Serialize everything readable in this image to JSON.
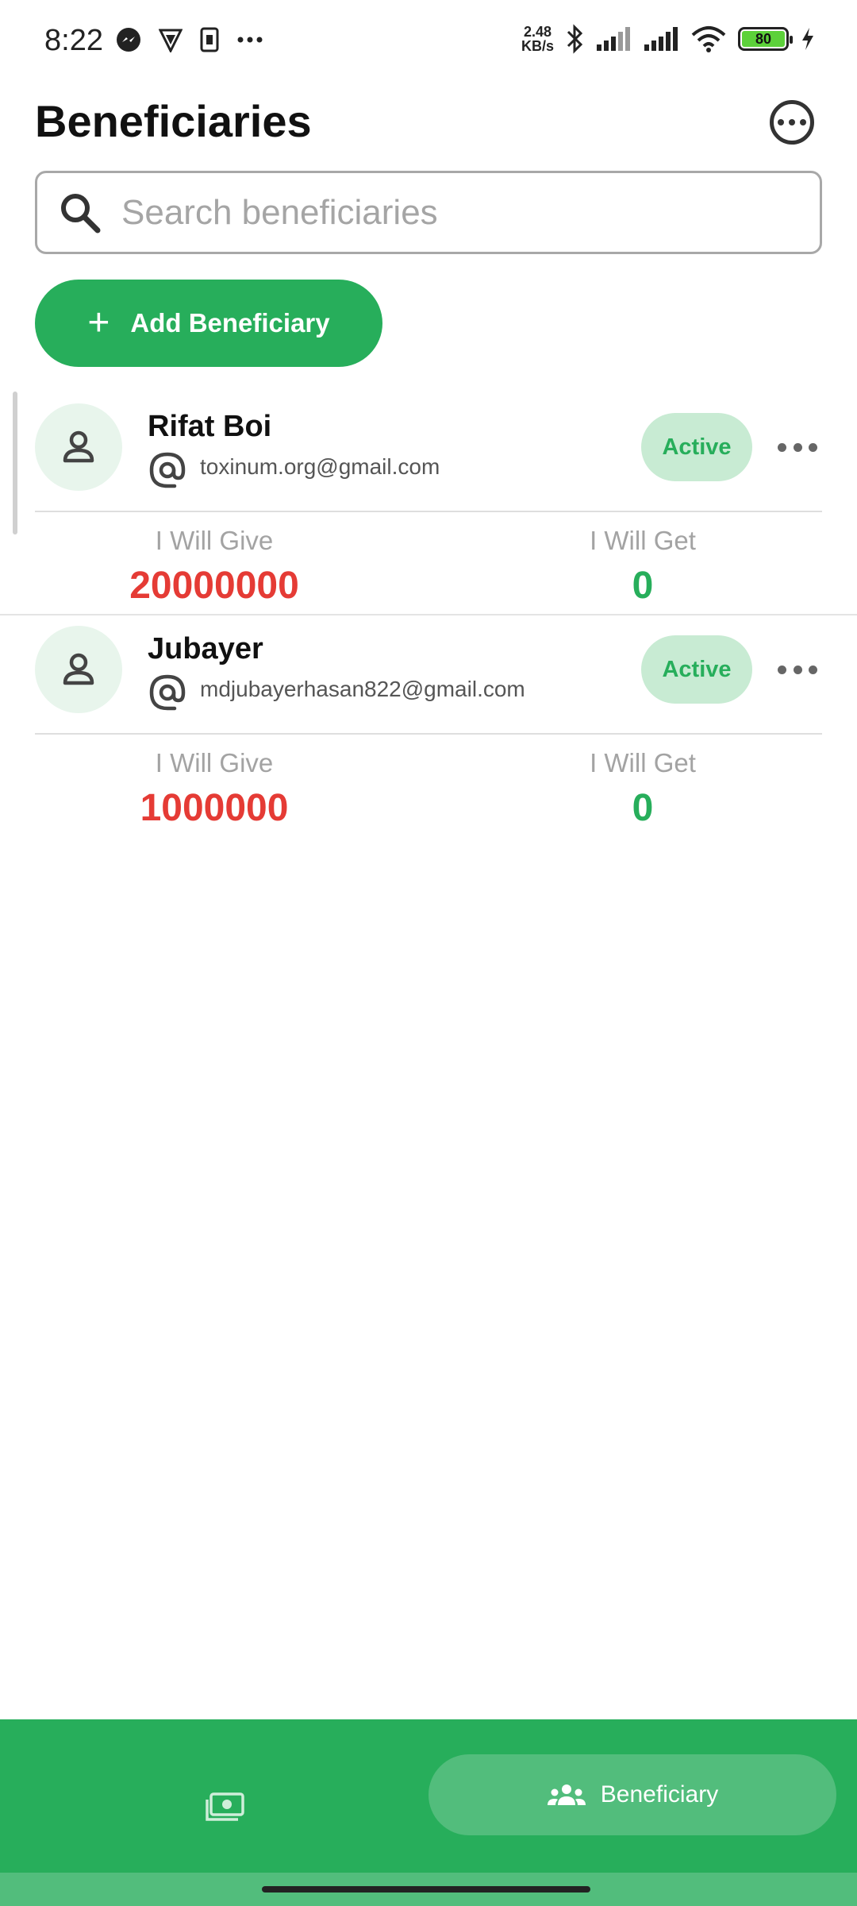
{
  "status_bar": {
    "time": "8:22",
    "speed_value": "2.48",
    "speed_unit": "KB/s",
    "battery_level": "80",
    "left_icons": [
      "messenger-icon",
      "vpn-icon",
      "sim-icon",
      "more-dots-icon"
    ],
    "right_icons": [
      "bluetooth-icon",
      "signal-icon",
      "signal-icon",
      "wifi-icon",
      "battery-icon",
      "charging-icon"
    ]
  },
  "header": {
    "title": "Beneficiaries",
    "more_icon": "more-circle-icon"
  },
  "search": {
    "placeholder": "Search beneficiaries",
    "value": ""
  },
  "add_button": {
    "label": "Add Beneficiary",
    "icon": "plus-icon"
  },
  "beneficiaries": [
    {
      "name": "Rifat Boi",
      "email": "toxinum.org@gmail.com",
      "status": "Active",
      "give_label": "I Will Give",
      "give_value": "20000000",
      "get_label": "I Will Get",
      "get_value": "0"
    },
    {
      "name": "Jubayer",
      "email": "mdjubayerhasan822@gmail.com",
      "status": "Active",
      "give_label": "I Will Give",
      "give_value": "1000000",
      "get_label": "I Will Get",
      "get_value": "0"
    }
  ],
  "bottom_nav": {
    "items": [
      {
        "icon": "money-icon",
        "label": ""
      },
      {
        "icon": "group-icon",
        "label": "Beneficiary"
      }
    ],
    "active_index": 1
  },
  "colors": {
    "brand_green": "#27ae5b",
    "give_red": "#e53b35",
    "badge_bg": "#c8ebd3",
    "avatar_bg": "#e8f5ec"
  }
}
